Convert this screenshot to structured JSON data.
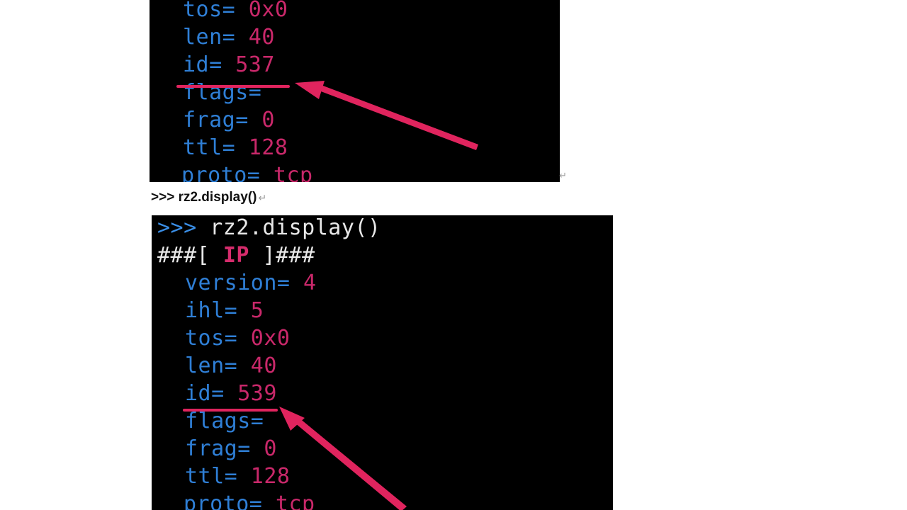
{
  "top_terminal": {
    "lines": [
      {
        "key": "tos=",
        "value": " 0x0"
      },
      {
        "key": "len=",
        "value": " 40"
      },
      {
        "key": "id=",
        "value": " 537"
      },
      {
        "key": "flags=",
        "value": ""
      },
      {
        "key": "frag=",
        "value": " 0"
      },
      {
        "key": "ttl=",
        "value": " 128"
      },
      {
        "key": "proto=",
        "value": " tcp"
      }
    ]
  },
  "document": {
    "command_text": ">>> rz2.display()",
    "paragraph_mark": "↵"
  },
  "bottom_terminal": {
    "prompt": ">>>",
    "command": " rz2.display()",
    "header_prefix": "###[ ",
    "header_layer": "IP",
    "header_suffix": " ]###",
    "lines": [
      {
        "key": "version=",
        "value": " 4"
      },
      {
        "key": "ihl=",
        "value": " 5"
      },
      {
        "key": "tos=",
        "value": " 0x0"
      },
      {
        "key": "len=",
        "value": " 40"
      },
      {
        "key": "id=",
        "value": " 539"
      },
      {
        "key": "flags=",
        "value": ""
      },
      {
        "key": "frag=",
        "value": " 0"
      },
      {
        "key": "ttl=",
        "value": " 128"
      },
      {
        "key": "proto=",
        "value": " tcp"
      }
    ]
  },
  "annotation_color": "#e0245e"
}
